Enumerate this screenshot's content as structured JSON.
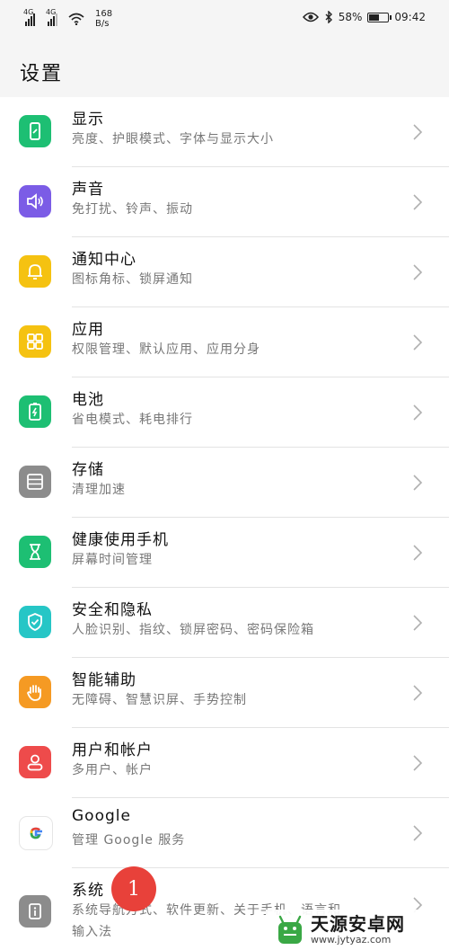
{
  "status_bar": {
    "signal1_label": "4G",
    "signal2_label": "4G",
    "net_speed_value": "168",
    "net_speed_unit": "B/s",
    "battery_percent": "58%",
    "battery_level": 0.58,
    "time": "09:42"
  },
  "header": {
    "title": "设置"
  },
  "settings": [
    {
      "label": "显示",
      "sub": "亮度、护眼模式、字体与显示大小",
      "color": "#1dbf73",
      "icon": "display-icon"
    },
    {
      "label": "声音",
      "sub": "免打扰、铃声、振动",
      "color": "#7b5ce6",
      "icon": "sound-icon"
    },
    {
      "label": "通知中心",
      "sub": "图标角标、锁屏通知",
      "color": "#f5c211",
      "icon": "bell-icon"
    },
    {
      "label": "应用",
      "sub": "权限管理、默认应用、应用分身",
      "color": "#f5c211",
      "icon": "apps-grid-icon"
    },
    {
      "label": "电池",
      "sub": "省电模式、耗电排行",
      "color": "#1dbf73",
      "icon": "battery-icon"
    },
    {
      "label": "存储",
      "sub": "清理加速",
      "color": "#8c8c8c",
      "icon": "storage-icon"
    },
    {
      "label": "健康使用手机",
      "sub": "屏幕时间管理",
      "color": "#1dbf73",
      "icon": "hourglass-icon"
    },
    {
      "label": "安全和隐私",
      "sub": "人脸识别、指纹、锁屏密码、密码保险箱",
      "color": "#26c6c6",
      "icon": "shield-icon"
    },
    {
      "label": "智能辅助",
      "sub": "无障碍、智慧识屏、手势控制",
      "color": "#f59a23",
      "icon": "hand-icon"
    },
    {
      "label": "用户和帐户",
      "sub": "多用户、帐户",
      "color": "#ee4b4b",
      "icon": "user-icon"
    },
    {
      "label": "Google",
      "sub": "管理 Google 服务",
      "color": "#ffffff",
      "icon": "google-icon"
    },
    {
      "label": "系统",
      "sub": "系统导航方式、软件更新、关于手机、语言和",
      "sub2": "输入法",
      "color": "#8c8c8c",
      "icon": "info-icon"
    }
  ],
  "overlay": {
    "step_badge": "1",
    "watermark_name": "天源安卓网",
    "watermark_url": "www.jytyaz.com"
  }
}
